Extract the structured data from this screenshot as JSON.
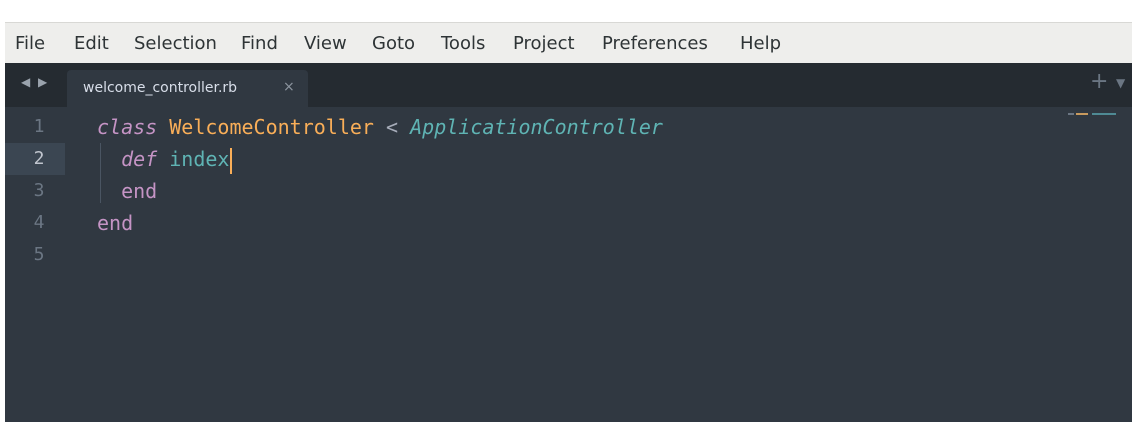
{
  "menu": [
    "File",
    "Edit",
    "Selection",
    "Find",
    "View",
    "Goto",
    "Tools",
    "Project",
    "Preferences",
    "Help"
  ],
  "tabs": [
    {
      "label": "welcome_controller.rb",
      "close": "×"
    }
  ],
  "tabbar": {
    "nav": "◀ ▶",
    "new_tab": "+",
    "dropdown": "▼"
  },
  "editor": {
    "active_line": 2,
    "line_numbers": [
      "1",
      "2",
      "3",
      "4",
      "5"
    ],
    "code": {
      "line1": {
        "kw": "class",
        "name": "WelcomeController",
        "op": "<",
        "parent": "ApplicationController"
      },
      "line2": {
        "kw": "def",
        "name": "index"
      },
      "line3": {
        "kw": "end"
      },
      "line4": {
        "kw": "end"
      }
    }
  },
  "colors": {
    "background": "#303841",
    "keyword": "#c594c5",
    "class_name": "#f9ae58",
    "function": "#5fb4b4",
    "caret": "#f9ae58"
  }
}
